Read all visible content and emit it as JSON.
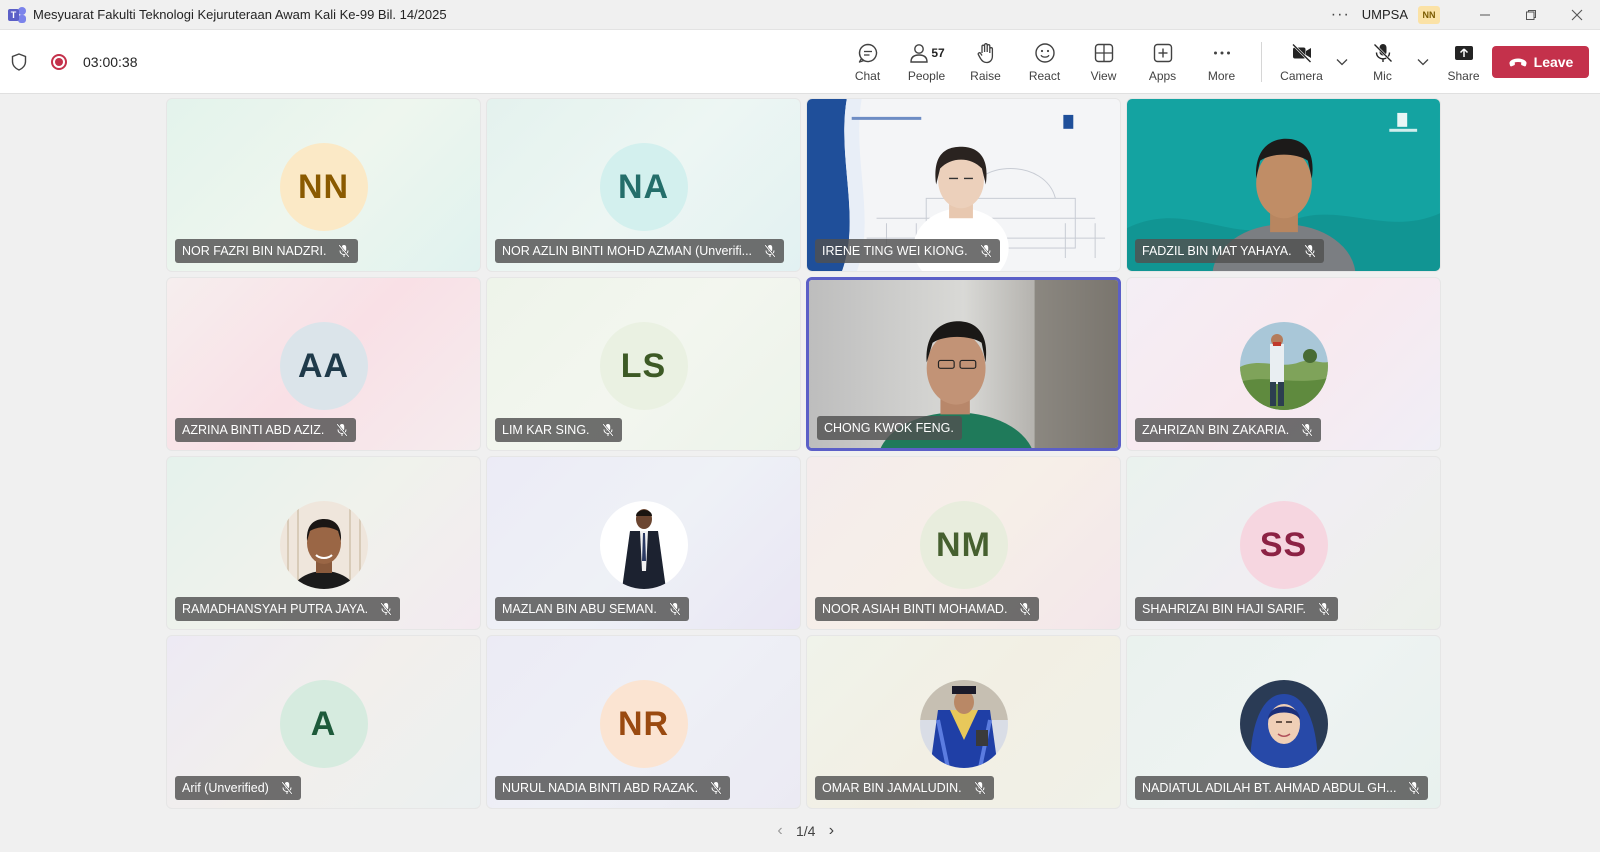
{
  "window": {
    "title": "Mesyuarat Fakulti Teknologi Kejuruteraan Awam Kali Ke-99 Bil. 14/2025",
    "more_glyph": "···",
    "org": "UMPSA",
    "user_initials": "NN"
  },
  "toolbar": {
    "timer": "03:00:38",
    "chat_label": "Chat",
    "people_label": "People",
    "people_count": "57",
    "raise_label": "Raise",
    "react_label": "React",
    "view_label": "View",
    "apps_label": "Apps",
    "more_label": "More",
    "camera_label": "Camera",
    "mic_label": "Mic",
    "share_label": "Share",
    "leave_label": "Leave"
  },
  "participants": [
    {
      "name": "NOR FAZRI BIN NADZRI.",
      "initials": "NN",
      "avatar_bg": "#fbe9c6",
      "avatar_fg": "#8a5a00",
      "tile_bg": "linear-gradient(135deg,#e3f3ec,#eef6ee,#e0f2ef)"
    },
    {
      "name": "NOR AZLIN BINTI MOHD AZMAN (Unverifi...",
      "initials": "NA",
      "avatar_bg": "#d3f0ee",
      "avatar_fg": "#246e6a",
      "tile_bg": "linear-gradient(135deg,#e4f2ee,#edf6f3,#e2f1f2)"
    },
    {
      "name": "IRENE TING WEI KIONG.",
      "initials": "",
      "video": "irene"
    },
    {
      "name": "FADZIL BIN MAT YAHAYA.",
      "initials": "",
      "video": "fadzil"
    },
    {
      "name": "AZRINA BINTI ABD AZIZ.",
      "initials": "AA",
      "avatar_bg": "#dbe4ea",
      "avatar_fg": "#1f3a4a",
      "tile_bg": "linear-gradient(135deg,#f6eeee,#f9e0e6,#f5ecee)"
    },
    {
      "name": "LIM KAR SING.",
      "initials": "LS",
      "avatar_bg": "#eaf1e2",
      "avatar_fg": "#3d5a25",
      "tile_bg": "linear-gradient(135deg,#eef4ea,#f3f6ef,#ecf3ea)"
    },
    {
      "name": "CHONG KWOK FENG.",
      "initials": "",
      "video": "chong",
      "active": true
    },
    {
      "name": "ZAHRIZAN BIN ZAKARIA.",
      "initials": "",
      "photo": "landscape",
      "tile_bg": "linear-gradient(135deg,#f4eef5,#f8e9ef,#f0eef6)"
    },
    {
      "name": "RAMADHANSYAH PUTRA JAYA.",
      "initials": "",
      "photo": "man1",
      "tile_bg": "linear-gradient(135deg,#e5f2ec,#f0f2ec,#f3eaf0)"
    },
    {
      "name": "MAZLAN BIN ABU SEMAN.",
      "initials": "",
      "photo": "suit",
      "tile_bg": "linear-gradient(135deg,#ecebf6,#eef1f6,#e9e6f4)"
    },
    {
      "name": "NOOR ASIAH BINTI MOHAMAD.",
      "initials": "NM",
      "avatar_bg": "#e8eddd",
      "avatar_fg": "#46602f",
      "tile_bg": "linear-gradient(135deg,#f4ecec,#f6efe8,#f3e6ea)"
    },
    {
      "name": "SHAHRIZAI BIN HAJI SARIF.",
      "initials": "SS",
      "avatar_bg": "#f6d6e0",
      "avatar_fg": "#8c2244",
      "tile_bg": "linear-gradient(135deg,#eaf2ee,#f0eef2,#ecf0ea)"
    },
    {
      "name": "Arif (Unverified)",
      "initials": "A",
      "avatar_bg": "#d6ebdf",
      "avatar_fg": "#1d5a3a",
      "tile_bg": "linear-gradient(135deg,#edeaf4,#f2efec,#ebf0f0)"
    },
    {
      "name": "NURUL NADIA BINTI ABD RAZAK.",
      "initials": "NR",
      "avatar_bg": "#fbe4d2",
      "avatar_fg": "#9a4a10",
      "tile_bg": "linear-gradient(135deg,#ecebf5,#eef0f6,#ebeaf3)"
    },
    {
      "name": "OMAR BIN JAMALUDIN.",
      "initials": "",
      "photo": "robe",
      "tile_bg": "linear-gradient(135deg,#f0f3ea,#f2efe4,#f0f1e8)"
    },
    {
      "name": "NADIATUL ADILAH BT. AHMAD ABDUL GH...",
      "initials": "",
      "photo": "hijab",
      "tile_bg": "linear-gradient(135deg,#eaf2ee,#eef3f2,#e8f1ee)"
    }
  ],
  "pager": {
    "prev_glyph": "‹",
    "next_glyph": "›",
    "page": "1/4"
  }
}
